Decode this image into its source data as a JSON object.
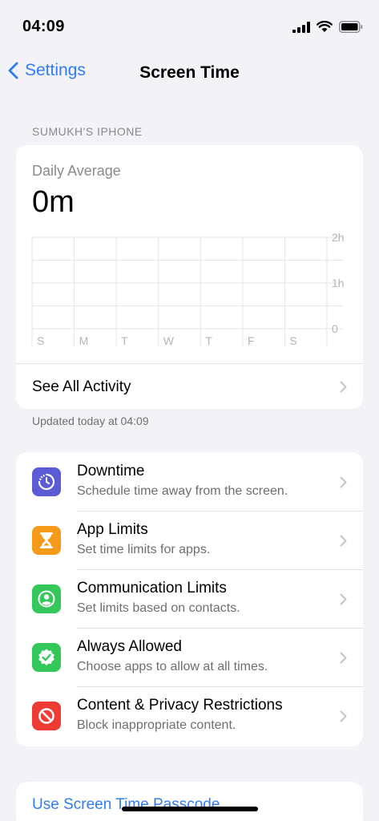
{
  "status_bar": {
    "time": "04:09"
  },
  "nav": {
    "back_label": "Settings",
    "title": "Screen Time"
  },
  "section_header": "SUMUKH'S IPHONE",
  "activity": {
    "daily_label": "Daily Average",
    "daily_value": "0m",
    "see_all_label": "See All Activity",
    "updated_label": "Updated today at 04:09"
  },
  "chart_data": {
    "type": "bar",
    "categories": [
      "S",
      "M",
      "T",
      "W",
      "T",
      "F",
      "S"
    ],
    "values": [
      0,
      0,
      0,
      0,
      0,
      0,
      0
    ],
    "y_ticks": [
      "2h",
      "1h",
      "0"
    ],
    "ylim": [
      0,
      2
    ],
    "grid": true
  },
  "options": [
    {
      "title": "Downtime",
      "subtitle": "Schedule time away from the screen.",
      "icon": "downtime-icon",
      "color": "#5b5bd6"
    },
    {
      "title": "App Limits",
      "subtitle": "Set time limits for apps.",
      "icon": "hourglass-icon",
      "color": "#f59a1b"
    },
    {
      "title": "Communication Limits",
      "subtitle": "Set limits based on contacts.",
      "icon": "contact-icon",
      "color": "#34c759"
    },
    {
      "title": "Always Allowed",
      "subtitle": "Choose apps to allow at all times.",
      "icon": "check-badge-icon",
      "color": "#34c759"
    },
    {
      "title": "Content & Privacy Restrictions",
      "subtitle": "Block inappropriate content.",
      "icon": "restriction-icon",
      "color": "#ee3b34"
    }
  ],
  "passcode": {
    "label": "Use Screen Time Passcode"
  },
  "colors": {
    "accent": "#2f7cf6",
    "background": "#f2f2f7"
  }
}
